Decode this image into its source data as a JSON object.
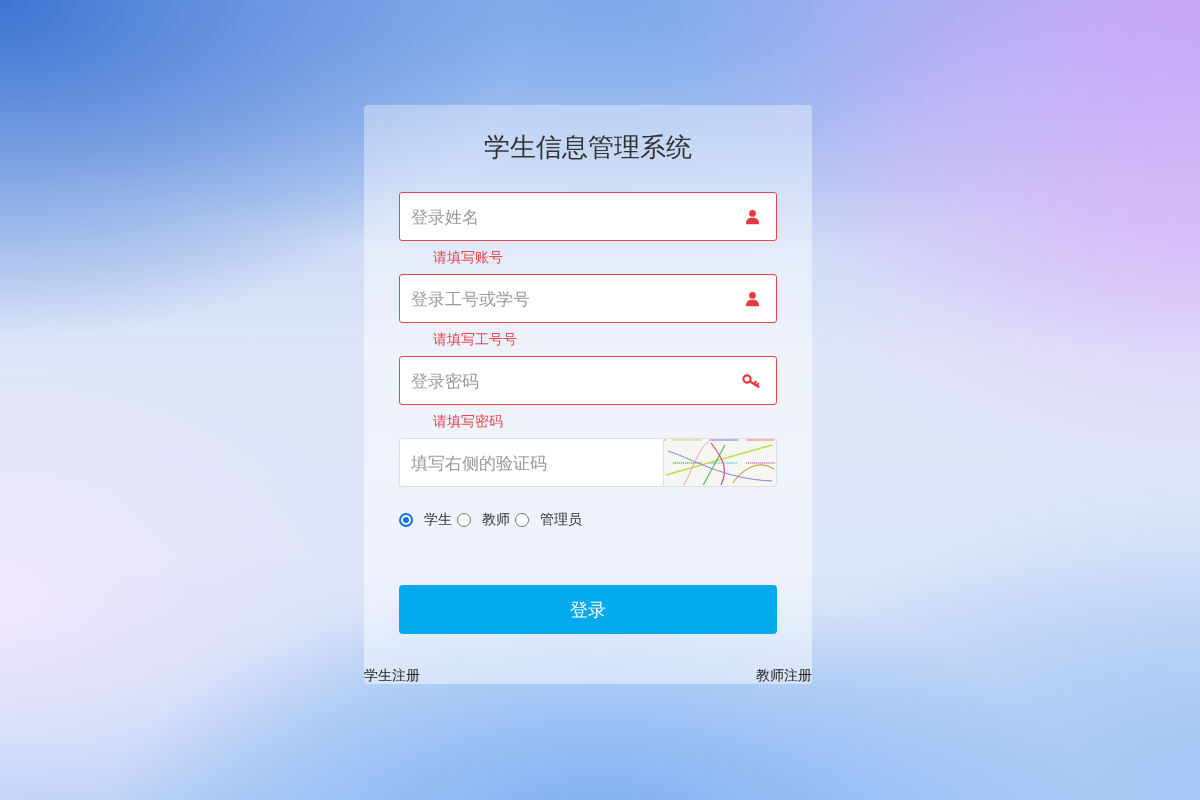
{
  "title": "学生信息管理系统",
  "fields": [
    {
      "kind": "account",
      "placeholder": "登录姓名",
      "invalid": true,
      "error": "请填写账号"
    },
    {
      "kind": "account",
      "placeholder": "登录工号或学号",
      "invalid": true,
      "error": "请填写工号号"
    },
    {
      "kind": "password",
      "placeholder": "登录密码",
      "invalid": true,
      "error": "请填写密码"
    },
    {
      "kind": "captcha",
      "placeholder": "填写右侧的验证码",
      "invalid": false
    }
  ],
  "roles": [
    {
      "label": "学生",
      "selected": true
    },
    {
      "label": "教师",
      "selected": false
    },
    {
      "label": "管理员",
      "selected": false
    }
  ],
  "login_button": "登录",
  "links": [
    "学生注册",
    "教师注册"
  ]
}
